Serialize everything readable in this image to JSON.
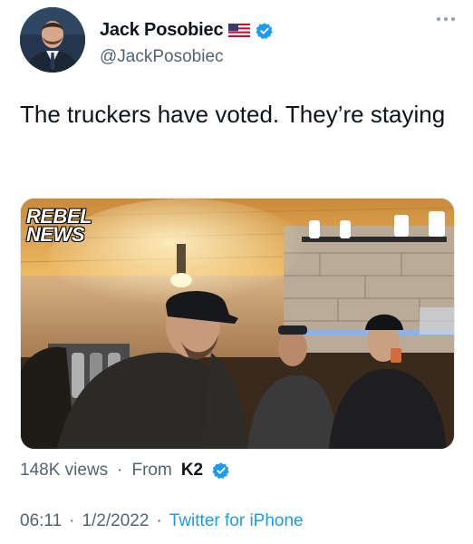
{
  "author": {
    "display_name": "Jack Posobiec",
    "handle": "@JackPosobiec",
    "flag_icon": "us-flag-icon",
    "verified_icon": "verified-badge-icon"
  },
  "tweet": {
    "text": "The truckers have voted. They’re staying"
  },
  "media": {
    "watermark": "REBEL\nNEWS"
  },
  "stats": {
    "views": "148K views",
    "separator": "·",
    "from_label": "From",
    "via_account": "K2"
  },
  "timestamp": {
    "time": "06:11",
    "separator": "·",
    "date": "1/2/2022",
    "separator2": "·",
    "source": "Twitter for iPhone"
  },
  "colors": {
    "link_blue": "#1d9bf0",
    "secondary_text": "#536471",
    "primary_text": "#0f1419"
  }
}
